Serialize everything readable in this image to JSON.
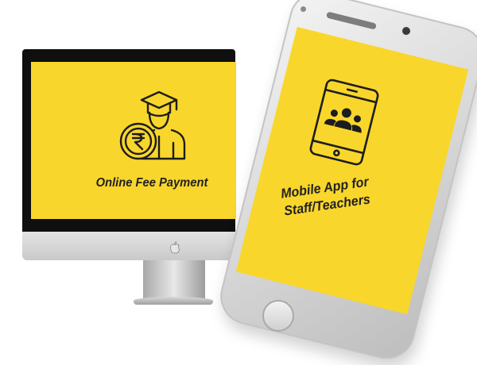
{
  "monitor": {
    "screen_color": "#f9d62b",
    "icon": "student-rupee-icon",
    "label": "Online Fee Payment",
    "logo": "apple-logo-icon"
  },
  "phone": {
    "screen_color": "#f9d62b",
    "icon": "mobile-group-icon",
    "label_line1": "Mobile App for",
    "label_line2": "Staff/Teachers"
  }
}
